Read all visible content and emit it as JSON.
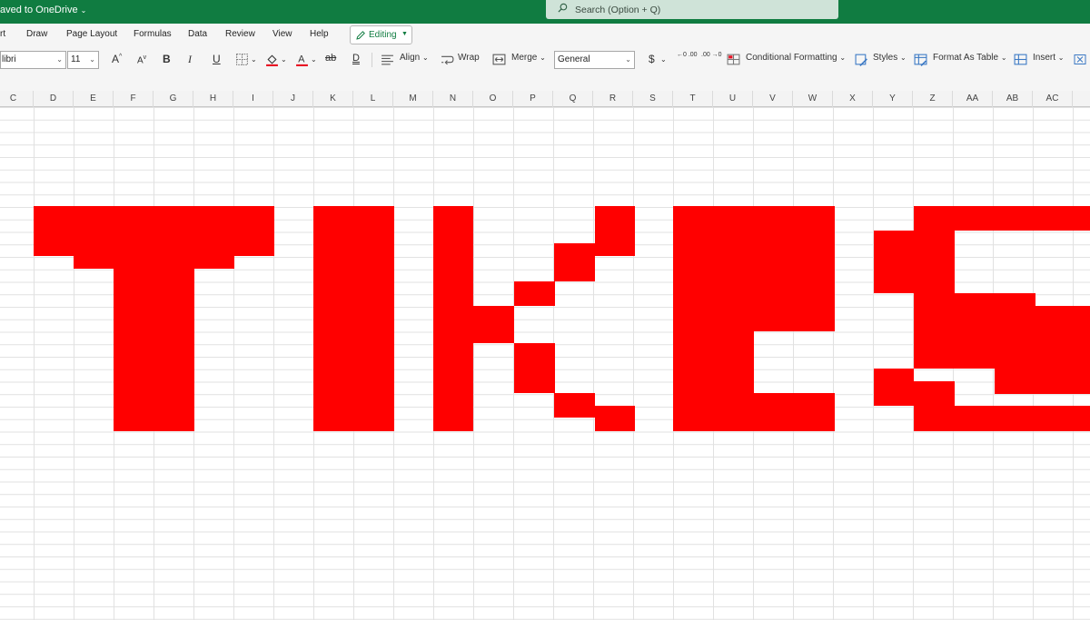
{
  "titlebar": {
    "saved_status": "aved to OneDrive",
    "search_placeholder": "Search (Option + Q)"
  },
  "menu": {
    "items": [
      "rt",
      "Draw",
      "Page Layout",
      "Formulas",
      "Data",
      "Review",
      "View",
      "Help"
    ],
    "editing_label": "Editing"
  },
  "ribbon": {
    "font_name": "libri",
    "font_size": "11",
    "grow_font": "A",
    "shrink_font": "A",
    "bold": "B",
    "italic": "I",
    "underline": "U",
    "strike": "ab",
    "double_underline": "D",
    "align_label": "Align",
    "wrap_label": "Wrap",
    "merge_label": "Merge",
    "number_format": "General",
    "currency": "$",
    "increase_decimal": "←0 .00",
    "decrease_decimal": ".00 →0",
    "conditional_formatting_label": "Conditional Formatting",
    "styles_label": "Styles",
    "format_as_table_label": "Format As Table",
    "insert_label": "Insert",
    "font_color": "#e81123",
    "fill_color": "#e81123"
  },
  "columns": [
    "C",
    "D",
    "E",
    "F",
    "G",
    "H",
    "I",
    "J",
    "K",
    "L",
    "M",
    "N",
    "O",
    "P",
    "Q",
    "R",
    "S",
    "T",
    "U",
    "V",
    "W",
    "X",
    "Y",
    "Z",
    "AA",
    "AB",
    "AC"
  ],
  "sheet": {
    "fill_color": "#ff0000",
    "filled_cells": "Red filled cells spelling YIKES"
  }
}
